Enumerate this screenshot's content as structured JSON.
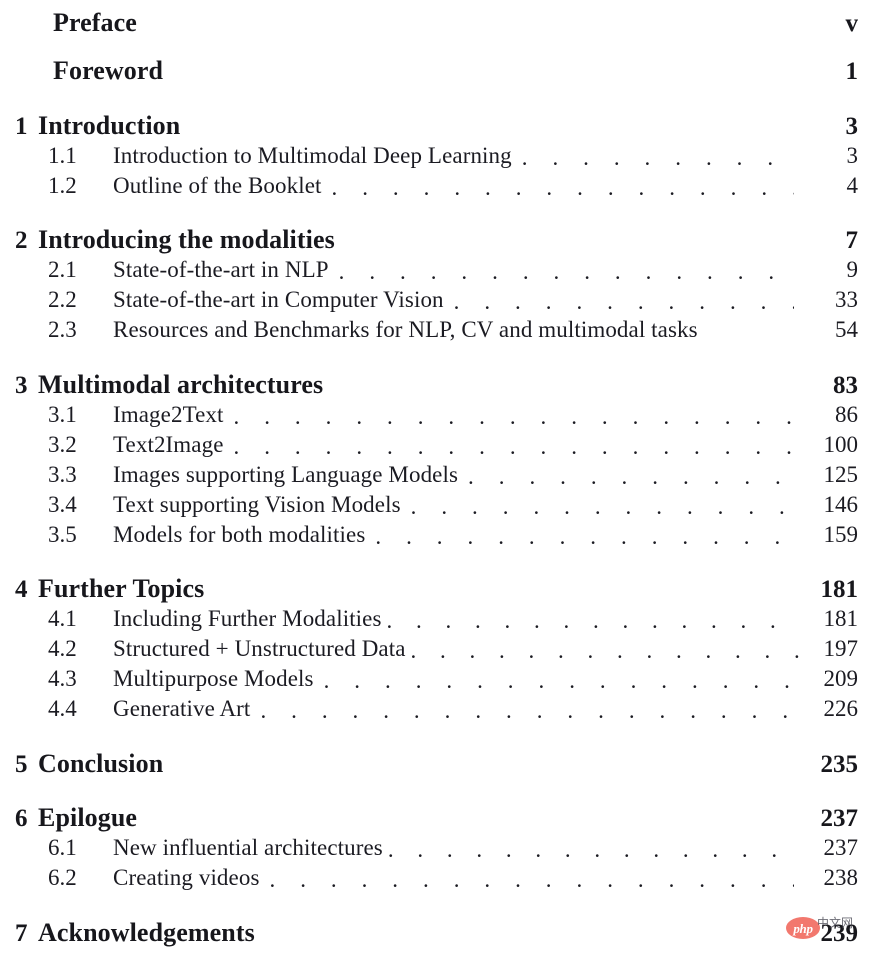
{
  "document": {
    "kind": "table-of-contents",
    "colors": {
      "text": "#17171c",
      "section_text": "#1b1b22",
      "background": "#ffffff",
      "watermark_badge": "#f2786e",
      "watermark_badge_text": "#ffffff"
    }
  },
  "entries": [
    {
      "type": "front",
      "number": "",
      "title": "Preface",
      "page": "v",
      "leader": false
    },
    {
      "type": "front",
      "number": "",
      "title": "Foreword",
      "page": "1",
      "leader": false
    },
    {
      "type": "chapter",
      "number": "1",
      "title": "Introduction",
      "page": "3",
      "leader": false
    },
    {
      "type": "section",
      "number": "1.1",
      "title": "Introduction to Multimodal Deep Learning",
      "page": "3",
      "leader": true,
      "tight": false
    },
    {
      "type": "section",
      "number": "1.2",
      "title": "Outline of the Booklet",
      "page": "4",
      "leader": true,
      "tight": false
    },
    {
      "type": "chapter",
      "number": "2",
      "title": "Introducing the modalities",
      "page": "7",
      "leader": false
    },
    {
      "type": "section",
      "number": "2.1",
      "title": "State-of-the-art in NLP",
      "page": "9",
      "leader": true,
      "tight": false
    },
    {
      "type": "section",
      "number": "2.2",
      "title": "State-of-the-art in Computer Vision",
      "page": "33",
      "leader": true,
      "tight": false
    },
    {
      "type": "section",
      "number": "2.3",
      "title": "Resources and Benchmarks for NLP, CV and multimodal tasks",
      "page": "54",
      "leader": false,
      "tight": false
    },
    {
      "type": "chapter",
      "number": "3",
      "title": "Multimodal architectures",
      "page": "83",
      "leader": false
    },
    {
      "type": "section",
      "number": "3.1",
      "title": "Image2Text",
      "page": "86",
      "leader": true,
      "tight": false
    },
    {
      "type": "section",
      "number": "3.2",
      "title": "Text2Image",
      "page": "100",
      "leader": true,
      "tight": false
    },
    {
      "type": "section",
      "number": "3.3",
      "title": "Images supporting Language Models",
      "page": "125",
      "leader": true,
      "tight": false
    },
    {
      "type": "section",
      "number": "3.4",
      "title": "Text supporting Vision Models",
      "page": "146",
      "leader": true,
      "tight": false
    },
    {
      "type": "section",
      "number": "3.5",
      "title": "Models for both modalities",
      "page": "159",
      "leader": true,
      "tight": false
    },
    {
      "type": "chapter",
      "number": "4",
      "title": "Further Topics",
      "page": "181",
      "leader": false
    },
    {
      "type": "section",
      "number": "4.1",
      "title": "Including Further Modalities",
      "page": "181",
      "leader": true,
      "tight": true
    },
    {
      "type": "section",
      "number": "4.2",
      "title": "Structured + Unstructured Data",
      "page": "197",
      "leader": true,
      "tight": true
    },
    {
      "type": "section",
      "number": "4.3",
      "title": "Multipurpose Models",
      "page": "209",
      "leader": true,
      "tight": false
    },
    {
      "type": "section",
      "number": "4.4",
      "title": "Generative Art",
      "page": "226",
      "leader": true,
      "tight": false
    },
    {
      "type": "chapter",
      "number": "5",
      "title": "Conclusion",
      "page": "235",
      "leader": false
    },
    {
      "type": "chapter",
      "number": "6",
      "title": "Epilogue",
      "page": "237",
      "leader": false
    },
    {
      "type": "section",
      "number": "6.1",
      "title": "New influential architectures",
      "page": "237",
      "leader": true,
      "tight": true
    },
    {
      "type": "section",
      "number": "6.2",
      "title": "Creating videos",
      "page": "238",
      "leader": true,
      "tight": false
    },
    {
      "type": "chapter",
      "number": "7",
      "title": "Acknowledgements",
      "page": "239",
      "leader": false
    }
  ],
  "layout": {
    "tops": [
      8,
      56,
      111,
      143,
      173,
      225,
      257,
      287,
      317,
      370,
      402,
      432,
      462,
      492,
      522,
      574,
      606,
      636,
      666,
      696,
      749,
      803,
      835,
      865,
      918
    ]
  },
  "watermark": {
    "badge_label": "php",
    "cn_label": "中文网"
  }
}
